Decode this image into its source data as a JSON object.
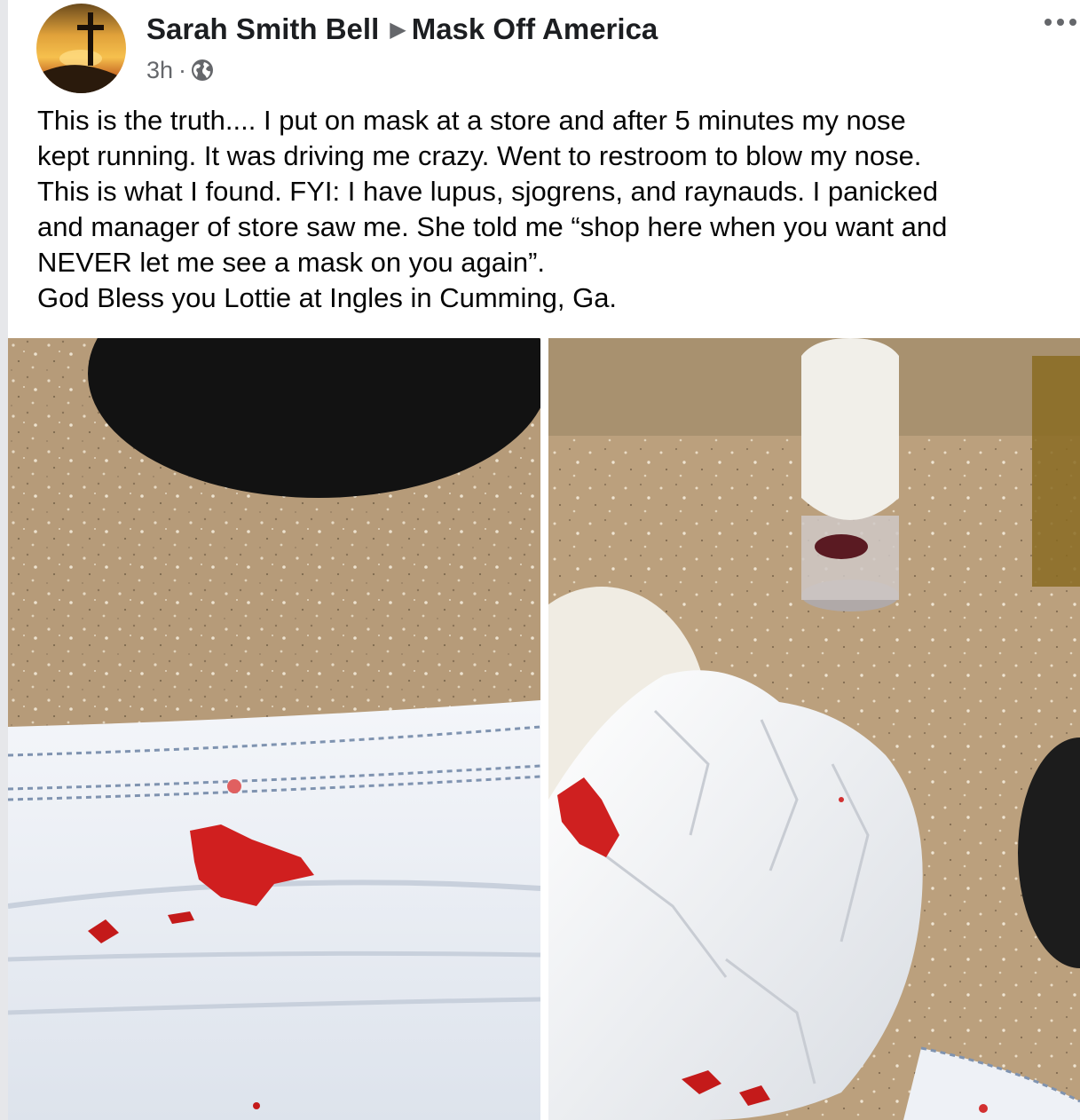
{
  "post": {
    "author": "Sarah Smith Bell",
    "group": "Mask Off America",
    "timestamp": "3h",
    "separator": "·",
    "privacy_icon": "globe-icon",
    "more_icon": "more-options-icon",
    "text_lines": [
      "This is the truth.... I put on mask at a store and after 5 minutes my nose",
      "kept running. It was driving me crazy. Went to restroom to blow my nose.",
      "This is what I found.  FYI: I have lupus, sjogrens, and raynauds. I panicked",
      "and manager of store saw me. She told me “shop here when you want and",
      "NEVER let me see a mask on you again”.",
      "God Bless you Lottie at Ingles in Cumming, Ga."
    ],
    "photos": [
      {
        "name": "photo-mask-with-blood"
      },
      {
        "name": "photo-tissue-with-blood"
      }
    ]
  },
  "colors": {
    "text": "#050505",
    "secondary_text": "#65676b",
    "divider": "#e6e7ea",
    "blood": "#d01f1f",
    "countertop": "#b49a78"
  }
}
